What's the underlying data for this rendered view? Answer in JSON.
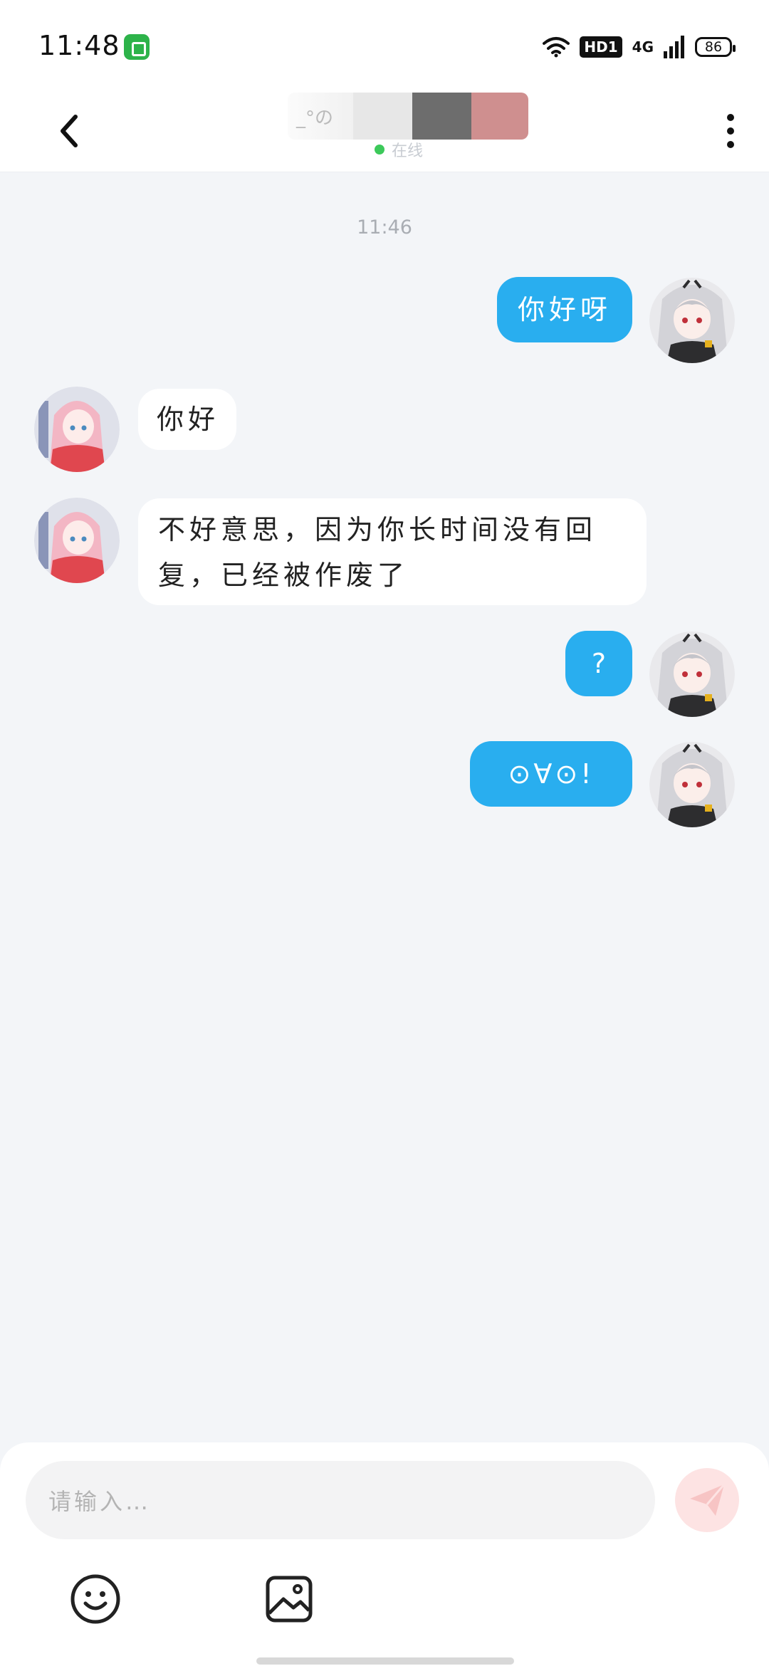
{
  "status_bar": {
    "time": "11:48",
    "hd_badge": "HD1",
    "network": "4G",
    "battery": "86",
    "icons": [
      "app-notification-icon",
      "wifi-icon",
      "signal-icon",
      "battery-icon"
    ]
  },
  "header": {
    "contact_name": "_°の",
    "online_status": "在线",
    "back_icon": "chevron-left-icon",
    "more_icon": "more-vertical-icon"
  },
  "chat": {
    "timestamp": "11:46",
    "messages": [
      {
        "side": "out",
        "text": "你好呀"
      },
      {
        "side": "in",
        "text": "你好"
      },
      {
        "side": "in",
        "text": "不好意思，因为你长时间没有回复，已经被作废了"
      },
      {
        "side": "out",
        "text": "?"
      },
      {
        "side": "out",
        "text": "⊙∀⊙!"
      }
    ]
  },
  "composer": {
    "placeholder": "请输入…",
    "send_icon": "send-icon",
    "emoji_icon": "emoji-icon",
    "image_icon": "image-icon"
  },
  "colors": {
    "outgoing_bubble": "#29aeef",
    "incoming_bubble": "#ffffff",
    "background": "#f3f5f8",
    "online": "#3cc95a",
    "send_button": "#fde3e3"
  }
}
